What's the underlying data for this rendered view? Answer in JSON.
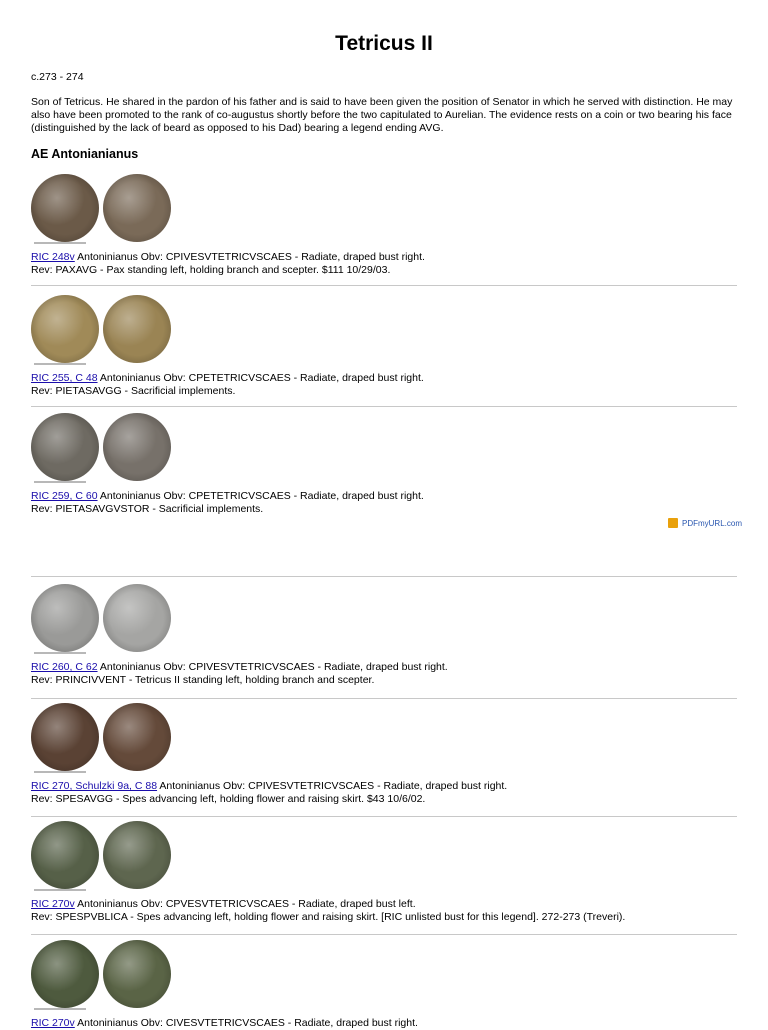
{
  "title": "Tetricus II",
  "dates": "c.273 - 274",
  "intro": "Son of Tetricus. He shared in the pardon of his father and is said to have been given the position of Senator in which he served with distinction. He may also have been promoted to the rank of co-augustus shortly before the two capitulated to Aurelian. The evidence rests on a coin or two bearing his face (distinguished by the lack of beard as opposed to his Dad) bearing a legend ending AVG.",
  "section_title": "AE Antonianianus",
  "pdf_badge": "PDFmyURL.com",
  "colors": {
    "link": "#1a0dab",
    "separator": "#c8c8c8",
    "badge_icon": "#e9a10c"
  },
  "entries": [
    {
      "ref": "RIC 248v",
      "line1": " Antoninianus Obv: CPIVESVTETRICVSCAES - Radiate, draped bust right.",
      "line2": "Rev: PAXAVG - Pax standing left, holding branch and scepter. $111 10/29/03.",
      "obverse_color": "#6b5a48",
      "reverse_color": "#7a6a58"
    },
    {
      "ref": "RIC 255, C 48",
      "line1": " Antoninianus Obv: CPETETRICVSCAES - Radiate, draped bust right.",
      "line2": "Rev: PIETASAVGG - Sacrificial implements.",
      "obverse_color": "#a08a58",
      "reverse_color": "#9a8454"
    },
    {
      "ref": "RIC 259, C 60",
      "line1": " Antoninianus Obv: CPETETRICVSCAES - Radiate, draped bust right.",
      "line2": "Rev: PIETASAVGVSTOR - Sacrificial implements.",
      "obverse_color": "#6e6a62",
      "reverse_color": "#77716a"
    },
    {
      "ref": "RIC 260, C 62",
      "line1": " Antoninianus Obv: CPIVESVTETRICVSCAES - Radiate, draped bust right.",
      "line2": "Rev: PRINCIVVENT - Tetricus II standing left, holding branch and scepter.",
      "obverse_color": "#9a9a98",
      "reverse_color": "#a5a5a3"
    },
    {
      "ref": "RIC 270, Schulzki 9a, C 88",
      "line1": " Antoninianus Obv: CPIVESVTETRICVSCAES - Radiate, draped bust right.",
      "line2": "Rev: SPESAVGG - Spes advancing left, holding flower and raising skirt. $43 10/6/02.",
      "obverse_color": "#5a4234",
      "reverse_color": "#644a3a"
    },
    {
      "ref": "RIC 270v",
      "line1": " Antoninianus Obv: CPVESVTETRICVSCAES - Radiate, draped bust left.",
      "line2": "Rev: SPESPVBLICA - Spes advancing left, holding flower and raising skirt. [RIC unlisted bust for this legend]. 272-273 (Treveri).",
      "obverse_color": "#566048",
      "reverse_color": "#5e664f"
    },
    {
      "ref": "RIC 270v",
      "line1": " Antoninianus Obv: CIVESVTETRICVSCAES - Radiate, draped bust right.",
      "line2": "",
      "obverse_color": "#4e5a3e",
      "reverse_color": "#5a6446"
    }
  ]
}
